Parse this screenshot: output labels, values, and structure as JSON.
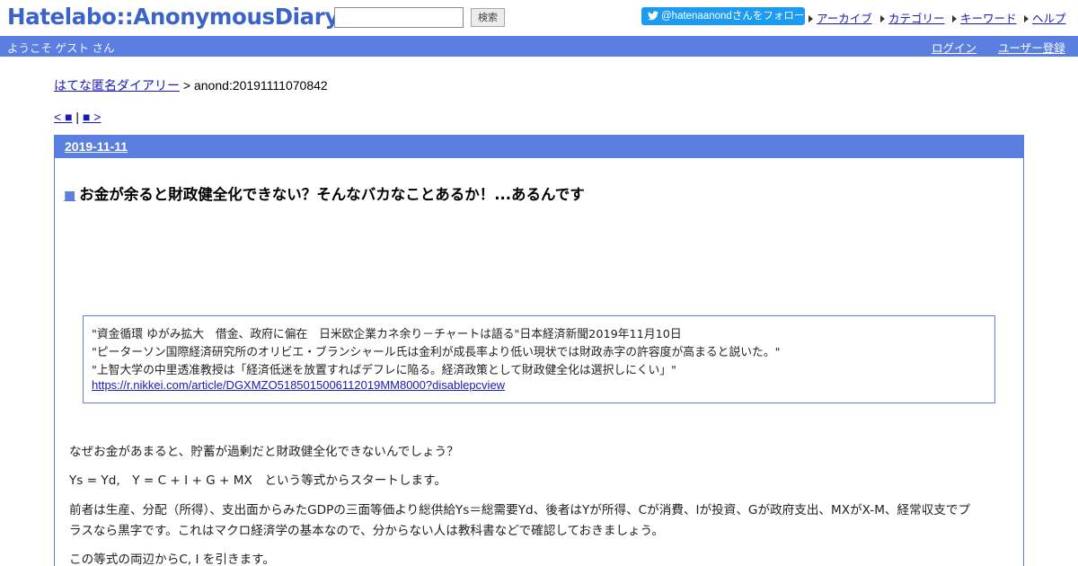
{
  "header": {
    "logo": "Hatelabo::AnonymousDiary",
    "search_value": "",
    "search_button": "検索",
    "twitter_follow": "@hatenaanondさんをフォロー",
    "links": [
      "アーカイブ",
      "カテゴリー",
      "キーワード",
      "ヘルプ"
    ]
  },
  "userbar": {
    "welcome": "ようこそ ゲスト さん",
    "login": "ログイン",
    "register": "ユーザー登録"
  },
  "breadcrumb": {
    "home": "はてな匿名ダイアリー",
    "separator": " > ",
    "current": "anond:20191111070842"
  },
  "pager": {
    "prev": "< ■",
    "divider": " | ",
    "next": "■ >"
  },
  "entry": {
    "date": "2019-11-11",
    "title_mark": "■",
    "title": "お金が余ると財政健全化できない？そんなバカなことあるか！...あるんです",
    "quote": [
      "\"資金循環 ゆがみ拡大　借金、政府に偏在　日米欧企業カネ余り－チャートは語る\"日本経済新聞2019年11月10日",
      "\"ピーターソン国際経済研究所のオリビエ・ブランシャール氏は金利が成長率より低い現状では財政赤字の許容度が高まると説いた。\"",
      "\"上智大学の中里透准教授は「経済低迷を放置すればデフレに陥る。経済政策として財政健全化は選択しにくい」\""
    ],
    "quote_link": "https://r.nikkei.com/article/DGXMZO5185015006112019MM8000?disablepcview",
    "paragraphs": [
      "なぜお金があまると、貯蓄が過剰だと財政健全化できないんでしょう？",
      "Ys = Yd,　Y = C + I + G + MX　という等式からスタートします。",
      "前者は生産、分配（所得）、支出面からみたGDPの三面等価より総供給Ys＝総需要Yd、後者はYが所得、Cが消費、Iが投資、Gが政府支出、MXがX-M、経常収支でプ",
      "ラスなら黒字です。これはマクロ経済学の基本なので、分からない人は教科書などで確認しておきましょう。",
      "この等式の両辺からC, I を引きます。"
    ]
  }
}
